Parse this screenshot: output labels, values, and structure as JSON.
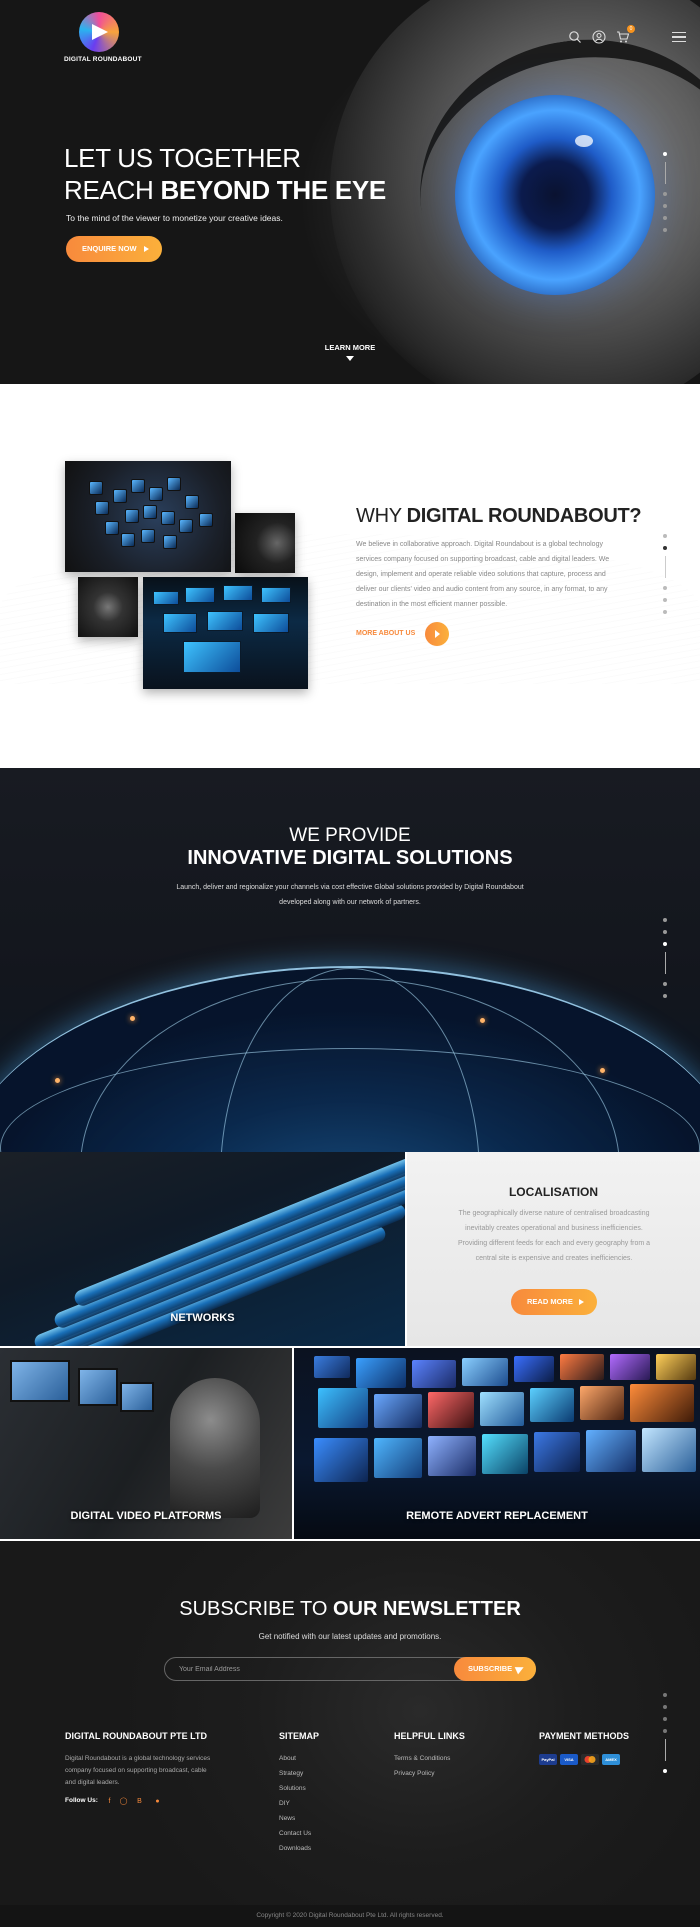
{
  "header": {
    "logo_text": "DIGITAL ROUNDABOUT",
    "icons": [
      "search-icon",
      "user-icon",
      "cart-icon",
      "menu-icon"
    ],
    "cart_count": "0"
  },
  "hero": {
    "title_line1": "LET US TOGETHER",
    "title_line2_light": "REACH ",
    "title_line2_bold": "BEYOND THE EYE",
    "subtitle": "To the mind of the viewer to monetize your creative ideas.",
    "cta_label": "ENQUIRE NOW",
    "learn_more": "LEARN MORE"
  },
  "why": {
    "title_light": "WHY ",
    "title_bold": "DIGITAL ROUNDABOUT?",
    "text": "We believe in collaborative approach. Digital Roundabout is a global technology services company focused on supporting broadcast, cable and digital leaders. We design, implement and operate reliable video solutions that capture, process and deliver our clients' video and audio content from any source, in any format, to any destination in the most efficient manner possible.",
    "link_label": "MORE ABOUT US"
  },
  "provide": {
    "heading_light": "WE PROVIDE",
    "heading_bold": "INNOVATIVE DIGITAL SOLUTIONS",
    "text": "Launch, deliver and regionalize your channels via cost effective Global solutions provided by Digital Roundabout developed along with our network of partners."
  },
  "solutions": {
    "networks": "NETWORKS",
    "localisation_title": "LOCALISATION",
    "localisation_text": "The geographically diverse nature of centralised broadcasting inevitably creates operational and business inefficiencies. Providing different feeds for each and every geography from a central site is expensive and creates inefficiencies.",
    "read_more": "READ MORE",
    "dvp": "DIGITAL VIDEO PLATFORMS",
    "remote": "REMOTE ADVERT REPLACEMENT"
  },
  "newsletter": {
    "title_light": "SUBSCRIBE TO ",
    "title_bold": "OUR NEWSLETTER",
    "subtitle": "Get notified with our latest updates and promotions.",
    "placeholder": "Your Email Address",
    "button": "SUBSCRIBE"
  },
  "footer": {
    "company": {
      "title": "DIGITAL ROUNDABOUT PTE LTD",
      "text": "Digital Roundabout is a global technology services company focused on supporting broadcast, cable and digital leaders.",
      "follow": "Follow Us:",
      "social": [
        "facebook-icon",
        "instagram-icon",
        "behance-icon",
        "pinterest-icon"
      ]
    },
    "sitemap": {
      "title": "SITEMAP",
      "items": [
        "About",
        "Strategy",
        "Solutions",
        "DIY",
        "News",
        "Contact Us",
        "Downloads"
      ]
    },
    "helpful": {
      "title": "HELPFUL LINKS",
      "items": [
        "Terms & Conditions",
        "Privacy Policy"
      ]
    },
    "payment": {
      "title": "PAYMENT METHODS",
      "methods": [
        {
          "label": "PayPal",
          "color": "#1d3c8f"
        },
        {
          "label": "VISA",
          "color": "#1a5ac8"
        },
        {
          "label": "MC",
          "color": "#2b2b2b"
        },
        {
          "label": "AMEX",
          "color": "#2e8fd8"
        }
      ]
    },
    "copyright": "Copyright © 2020 Digital Roundabout Pte Ltd. All rights reserved."
  },
  "colors": {
    "accent": "#f7893b",
    "accent_light": "#fbb03b",
    "dark": "#181b22"
  }
}
